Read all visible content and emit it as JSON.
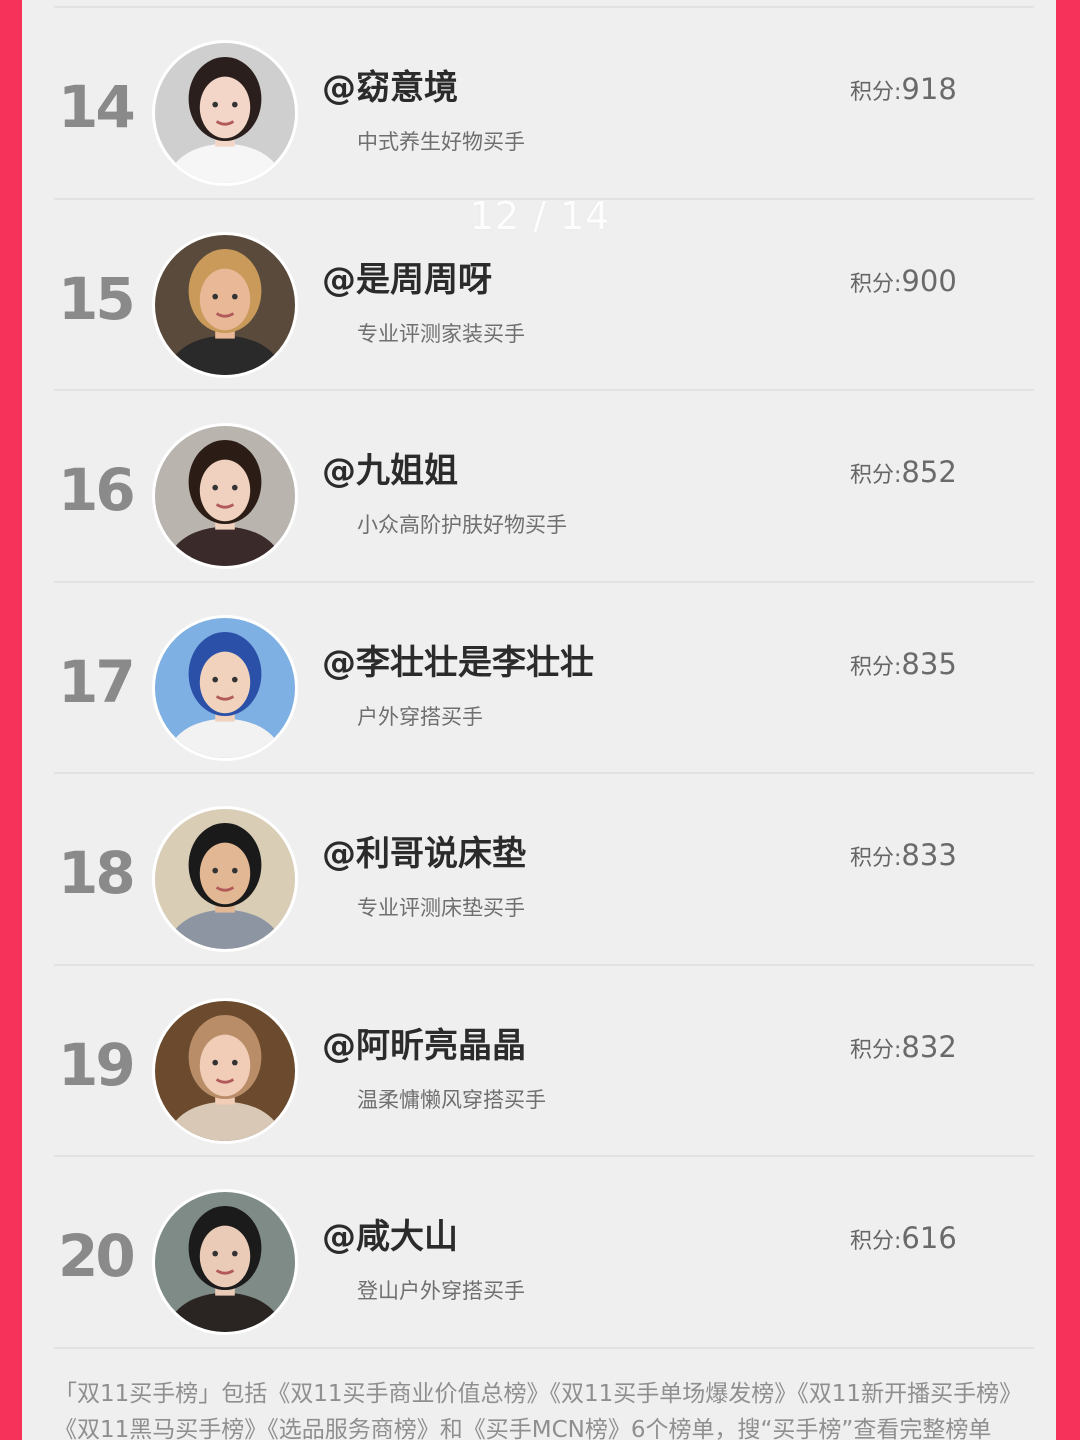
{
  "page_indicator": "12 / 14",
  "score_label": "积分:",
  "rows": [
    {
      "rank": "14",
      "name": "@窈意境",
      "desc": "中式养生好物买手",
      "score": "918",
      "avatar_colors": {
        "bg": "#cfcfcf",
        "skin": "#f3d6c8",
        "hair": "#2a1f1c",
        "cloth": "#f6f6f6"
      }
    },
    {
      "rank": "15",
      "name": "@是周周呀",
      "desc": "专业评测家装买手",
      "score": "900",
      "avatar_colors": {
        "bg": "#5a4a3c",
        "skin": "#e8b897",
        "hair": "#c99a5a",
        "cloth": "#2a2a2a"
      }
    },
    {
      "rank": "16",
      "name": "@九姐姐",
      "desc": "小众高阶护肤好物买手",
      "score": "852",
      "avatar_colors": {
        "bg": "#b9b4ae",
        "skin": "#f0d1bf",
        "hair": "#2b1d16",
        "cloth": "#3a2a2a"
      }
    },
    {
      "rank": "17",
      "name": "@李壮壮是李壮壮",
      "desc": "户外穿搭买手",
      "score": "835",
      "avatar_colors": {
        "bg": "#7fb0e3",
        "skin": "#f1d3bd",
        "hair": "#2b50a8",
        "cloth": "#f2f2f2"
      }
    },
    {
      "rank": "18",
      "name": "@利哥说床垫",
      "desc": "专业评测床垫买手",
      "score": "833",
      "avatar_colors": {
        "bg": "#d9cdb6",
        "skin": "#e2b894",
        "hair": "#1a1a1a",
        "cloth": "#8d95a3"
      }
    },
    {
      "rank": "19",
      "name": "@阿昕亮晶晶",
      "desc": "温柔慵懒风穿搭买手",
      "score": "832",
      "avatar_colors": {
        "bg": "#6b4a2e",
        "skin": "#f1cdb7",
        "hair": "#b98d68",
        "cloth": "#d8c8b5"
      }
    },
    {
      "rank": "20",
      "name": "@咸大山",
      "desc": "登山户外穿搭买手",
      "score": "616",
      "avatar_colors": {
        "bg": "#7f8b86",
        "skin": "#e9cbb7",
        "hair": "#1b1b1b",
        "cloth": "#2a2522"
      }
    }
  ],
  "footer": "「双11买手榜」包括《双11买手商业价值总榜》《双11买手单场爆发榜》《双11新开播买手榜》《双11黑马买手榜》《选品服务商榜》和《买手MCN榜》6个榜单，搜“买手榜”查看完整榜单"
}
